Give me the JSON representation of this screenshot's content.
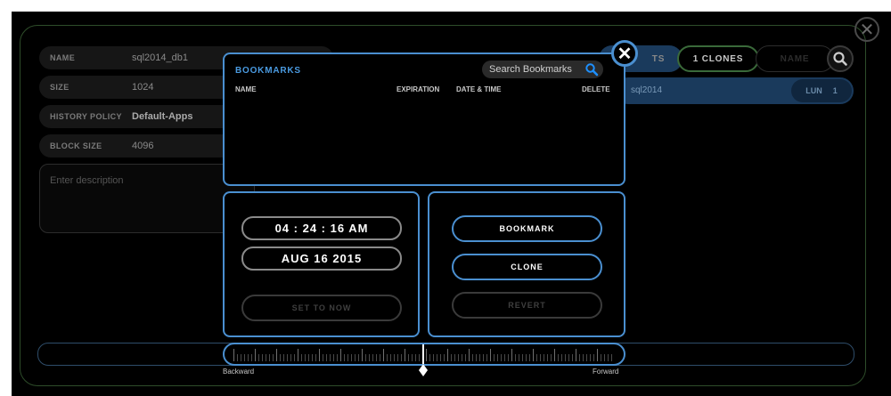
{
  "details": {
    "name": {
      "label": "NAME",
      "value": "sql2014_db1"
    },
    "size": {
      "label": "SIZE",
      "value": "1024"
    },
    "history_policy": {
      "label": "HISTORY POLICY",
      "value": "Default-Apps"
    },
    "block_size": {
      "label": "BLOCK SIZE",
      "value": "4096"
    },
    "description_placeholder": "Enter description"
  },
  "right_panel": {
    "tabs": [
      {
        "label": "TS"
      },
      {
        "label": "1 CLONES"
      },
      {
        "label": "NAME"
      }
    ],
    "row": {
      "name": "sql2014",
      "lun_label": "LUN",
      "lun_value": "1"
    }
  },
  "bookmarks": {
    "title": "BOOKMARKS",
    "search_placeholder": "Search Bookmarks",
    "columns": {
      "name": "NAME",
      "expiration": "EXPIRATION",
      "date_time": "DATE & TIME",
      "delete": "DELETE"
    },
    "rows": []
  },
  "time_controls": {
    "time": "04 : 24 : 16  AM",
    "date": "AUG  16  2015",
    "set_to_now": "SET TO NOW"
  },
  "actions": {
    "bookmark": "BOOKMARK",
    "clone": "CLONE",
    "revert": "REVERT"
  },
  "timeline": {
    "backward_label": "Backward",
    "forward_label": "Forward"
  },
  "icons": {
    "close": "close-icon",
    "search": "search-icon"
  },
  "colors": {
    "accent_blue": "#4a8fd0",
    "search_blue": "#1e90ff",
    "frame_green": "#3a6a3a"
  }
}
